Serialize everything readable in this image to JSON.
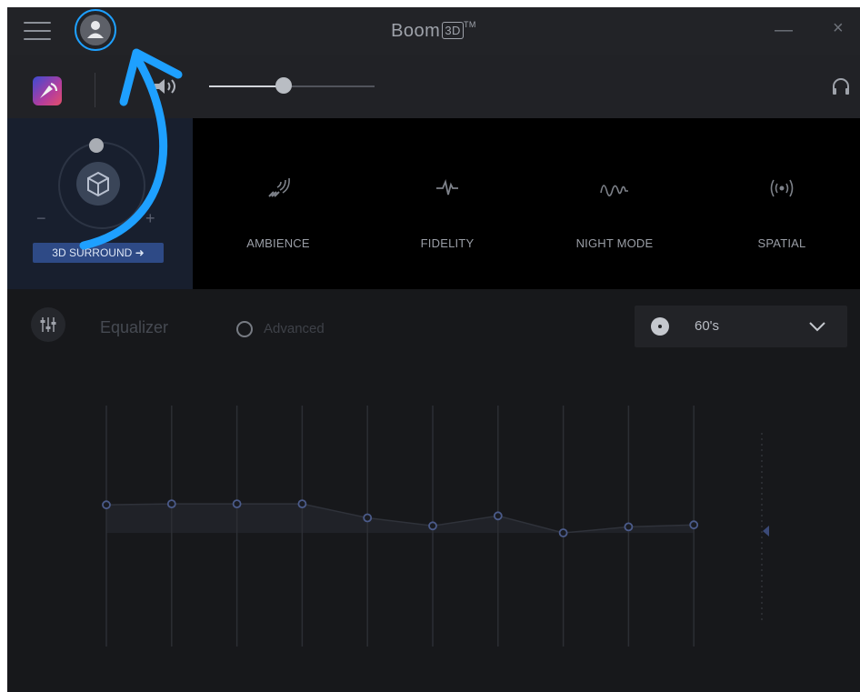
{
  "titlebar": {
    "app_name": "Boom",
    "logo_3d": "3D",
    "trademark": "TM",
    "menu_icon": "hamburger-menu-icon",
    "profile_icon": "user-profile-icon",
    "minimize_glyph": "—",
    "close_glyph": "×"
  },
  "volume": {
    "level": 0.45,
    "speaker_icon": "speaker-icon",
    "output_icon": "headphones-icon"
  },
  "surround": {
    "minus": "−",
    "plus": "+",
    "button_label": "3D SURROUND ➜",
    "cube_icon": "3d-cube-icon"
  },
  "effects": [
    {
      "label": "AMBIENCE",
      "icon": "ambience-waves-icon"
    },
    {
      "label": "FIDELITY",
      "icon": "fidelity-pulse-icon"
    },
    {
      "label": "NIGHT MODE",
      "icon": "night-mode-wave-icon"
    },
    {
      "label": "SPATIAL",
      "icon": "spatial-broadcast-icon"
    }
  ],
  "equalizer": {
    "label": "Equalizer",
    "advanced_label": "Advanced",
    "preset": "60's",
    "band_levels": [
      0.28,
      0.29,
      0.29,
      0.29,
      0.15,
      0.07,
      0.17,
      0.0,
      0.06,
      0.08
    ]
  },
  "annotation": {
    "color": "#1ea0ff"
  }
}
